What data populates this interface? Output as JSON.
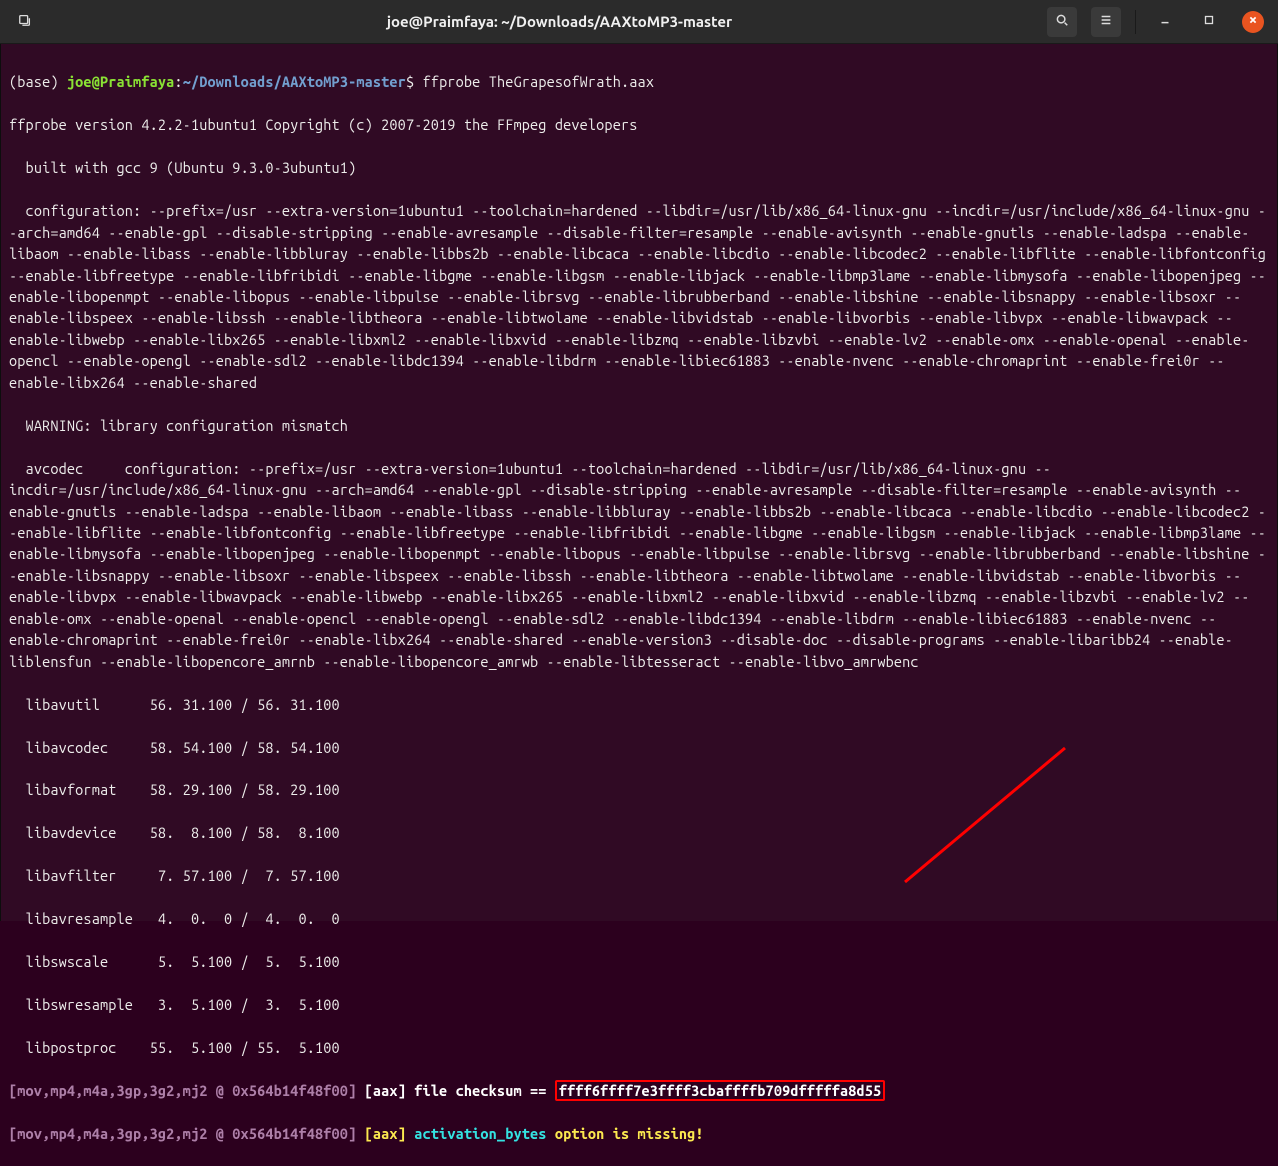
{
  "window": {
    "title": "joe@Praimfaya: ~/Downloads/AAXtoMP3-master"
  },
  "prompt": {
    "prefix": "(base) ",
    "user_host": "joe@Praimfaya",
    "colon": ":",
    "path": "~/Downloads/AAXtoMP3-master",
    "dollar": "$",
    "command": " ffprobe TheGrapesofWrath.aax"
  },
  "output": {
    "line1": "ffprobe version 4.2.2-1ubuntu1 Copyright (c) 2007-2019 the FFmpeg developers",
    "line2": "  built with gcc 9 (Ubuntu 9.3.0-3ubuntu1)",
    "config": "  configuration: --prefix=/usr --extra-version=1ubuntu1 --toolchain=hardened --libdir=/usr/lib/x86_64-linux-gnu --incdir=/usr/include/x86_64-linux-gnu --arch=amd64 --enable-gpl --disable-stripping --enable-avresample --disable-filter=resample --enable-avisynth --enable-gnutls --enable-ladspa --enable-libaom --enable-libass --enable-libbluray --enable-libbs2b --enable-libcaca --enable-libcdio --enable-libcodec2 --enable-libflite --enable-libfontconfig --enable-libfreetype --enable-libfribidi --enable-libgme --enable-libgsm --enable-libjack --enable-libmp3lame --enable-libmysofa --enable-libopenjpeg --enable-libopenmpt --enable-libopus --enable-libpulse --enable-librsvg --enable-librubberband --enable-libshine --enable-libsnappy --enable-libsoxr --enable-libspeex --enable-libssh --enable-libtheora --enable-libtwolame --enable-libvidstab --enable-libvorbis --enable-libvpx --enable-libwavpack --enable-libwebp --enable-libx265 --enable-libxml2 --enable-libxvid --enable-libzmq --enable-libzvbi --enable-lv2 --enable-omx --enable-openal --enable-opencl --enable-opengl --enable-sdl2 --enable-libdc1394 --enable-libdrm --enable-libiec61883 --enable-nvenc --enable-chromaprint --enable-frei0r --enable-libx264 --enable-shared",
    "warn": "  WARNING: library configuration mismatch",
    "avcodec": "  avcodec     configuration: --prefix=/usr --extra-version=1ubuntu1 --toolchain=hardened --libdir=/usr/lib/x86_64-linux-gnu --incdir=/usr/include/x86_64-linux-gnu --arch=amd64 --enable-gpl --disable-stripping --enable-avresample --disable-filter=resample --enable-avisynth --enable-gnutls --enable-ladspa --enable-libaom --enable-libass --enable-libbluray --enable-libbs2b --enable-libcaca --enable-libcdio --enable-libcodec2 --enable-libflite --enable-libfontconfig --enable-libfreetype --enable-libfribidi --enable-libgme --enable-libgsm --enable-libjack --enable-libmp3lame --enable-libmysofa --enable-libopenjpeg --enable-libopenmpt --enable-libopus --enable-libpulse --enable-librsvg --enable-librubberband --enable-libshine --enable-libsnappy --enable-libsoxr --enable-libspeex --enable-libssh --enable-libtheora --enable-libtwolame --enable-libvidstab --enable-libvorbis --enable-libvpx --enable-libwavpack --enable-libwebp --enable-libx265 --enable-libxml2 --enable-libxvid --enable-libzmq --enable-libzvbi --enable-lv2 --enable-omx --enable-openal --enable-opencl --enable-opengl --enable-sdl2 --enable-libdc1394 --enable-libdrm --enable-libiec61883 --enable-nvenc --enable-chromaprint --enable-frei0r --enable-libx264 --enable-shared --enable-version3 --disable-doc --disable-programs --enable-libaribb24 --enable-liblensfun --enable-libopencore_amrnb --enable-libopencore_amrwb --enable-libtesseract --enable-libvo_amrwbenc",
    "libs": [
      "  libavutil      56. 31.100 / 56. 31.100",
      "  libavcodec     58. 54.100 / 58. 54.100",
      "  libavformat    58. 29.100 / 58. 29.100",
      "  libavdevice    58.  8.100 / 58.  8.100",
      "  libavfilter     7. 57.100 /  7. 57.100",
      "  libavresample   4.  0.  0 /  4.  0.  0",
      "  libswscale      5.  5.100 /  5.  5.100",
      "  libswresample   3.  5.100 /  3.  5.100",
      "  libpostproc    55.  5.100 / 55.  5.100"
    ],
    "aax1": {
      "tag": "[mov,mp4,m4a,3gp,3g2,mj2 @ 0x564b14f48f00]",
      "aax": " [aax] ",
      "msg": "file checksum == ",
      "checksum": "ffff6ffff7e3ffff3cbaffffb709dfffffa8d55"
    },
    "aax2": {
      "tag": "[mov,mp4,m4a,3gp,3g2,mj2 @ 0x564b14f48f00]",
      "aax": " [aax] ",
      "part1": "activation_bytes ",
      "part2": "option ",
      "part3": "is missing!"
    }
  },
  "icons": {
    "newtab": "new-tab-icon",
    "search": "search-icon",
    "menu": "hamburger-icon",
    "min": "minimize-icon",
    "max": "maximize-icon",
    "close": "close-icon"
  }
}
